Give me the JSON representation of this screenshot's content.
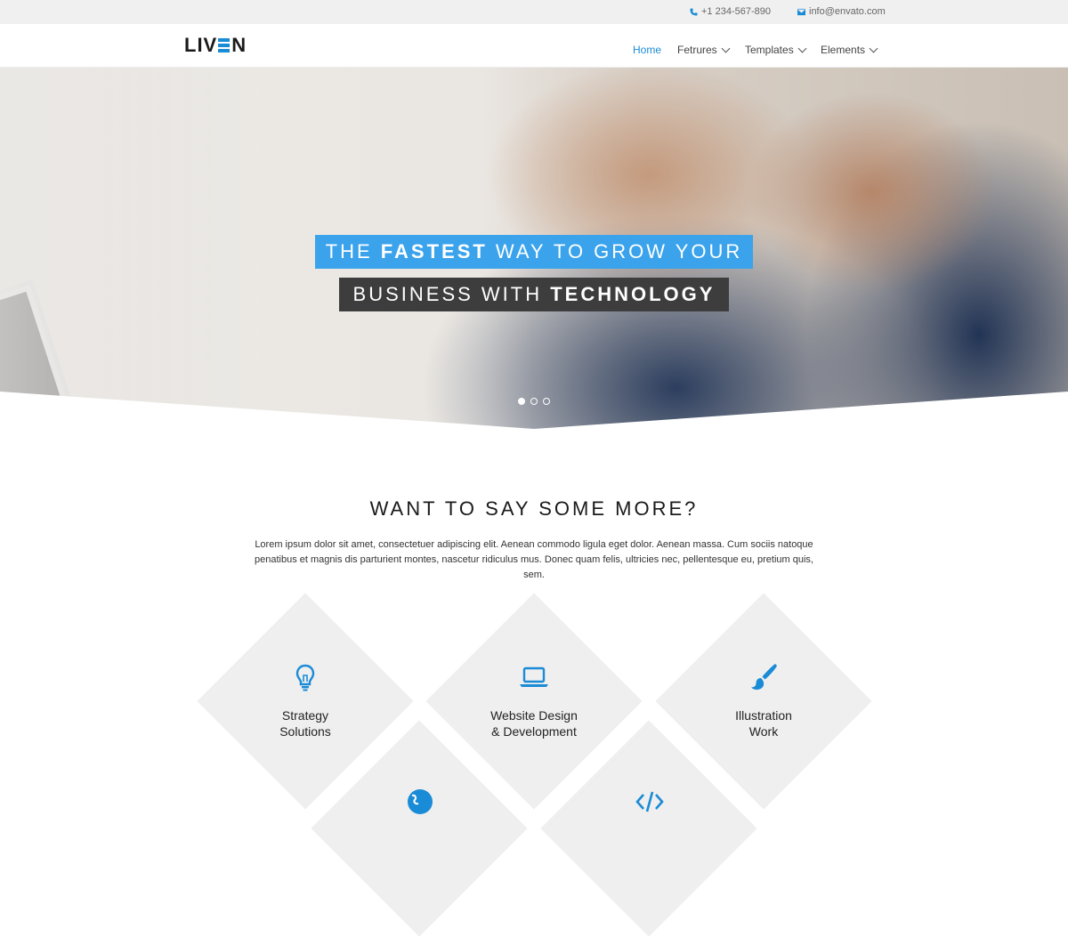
{
  "topbar": {
    "phone": "+1 234-567-890",
    "email": "info@envato.com",
    "phone_icon": "phone-icon",
    "email_icon": "envelope-icon"
  },
  "header": {
    "logo_left": "LIV",
    "logo_right": "N",
    "nav": [
      {
        "label": "Home",
        "active": true
      },
      {
        "label": "Fetrures",
        "dropdown": true
      },
      {
        "label": "Templates",
        "dropdown": true
      },
      {
        "label": "Elements",
        "dropdown": true
      }
    ]
  },
  "hero": {
    "line1_pre": "THE ",
    "line1_bold": "FASTEST",
    "line1_post": " WAY TO GROW YOUR",
    "line2_pre": "BUSINESS WITH ",
    "line2_bold": "TECHNOLOGY",
    "slides": 3,
    "active_slide": 1
  },
  "section": {
    "title": "WANT TO SAY SOME MORE?",
    "text": "Lorem ipsum dolor sit amet, consectetuer adipiscing elit. Aenean commodo ligula eget dolor. Aenean massa. Cum sociis natoque penatibus et magnis dis parturient montes, nascetur ridiculus mus. Donec quam felis, ultricies nec, pellentesque eu, pretium quis, sem."
  },
  "services": [
    {
      "line1": "Strategy",
      "line2": "Solutions",
      "icon": "lightbulb-icon"
    },
    {
      "line1": "Website Design",
      "line2": "& Development",
      "icon": "laptop-icon"
    },
    {
      "line1": "Illustration",
      "line2": "Work",
      "icon": "paintbrush-icon"
    },
    {
      "line1": "",
      "line2": "",
      "icon": "globe-icon"
    },
    {
      "line1": "",
      "line2": "",
      "icon": "code-icon"
    }
  ],
  "colors": {
    "accent": "#1a8bd6",
    "headline_blue": "#3aa3ec",
    "headline_dark": "#3d3d3d",
    "card_bg": "#efefef"
  }
}
